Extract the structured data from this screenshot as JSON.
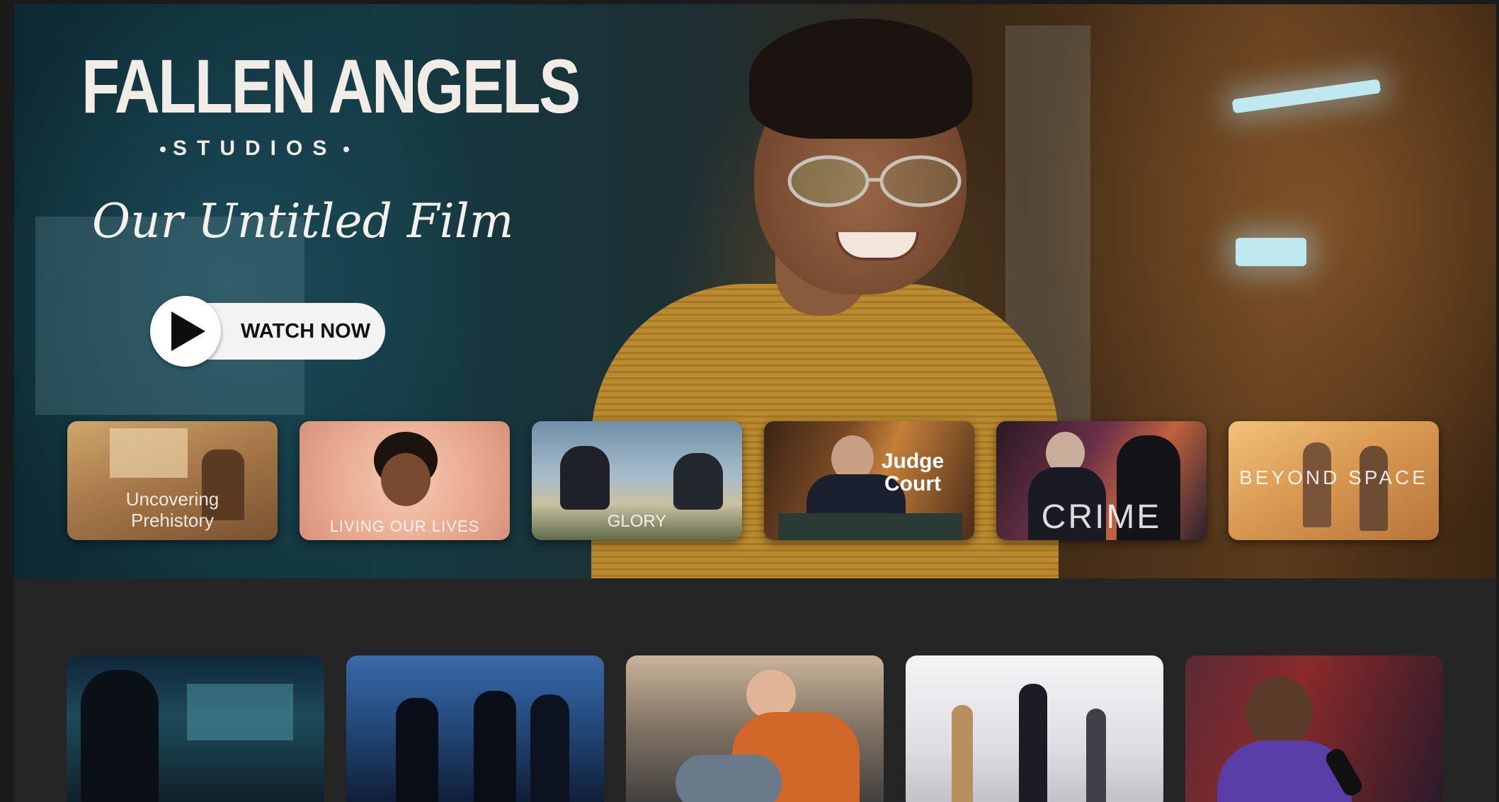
{
  "hero": {
    "logo_title": "FALLEN ANGELS",
    "logo_subtitle": "STUDIOS",
    "film_title": "Our Untitled Film",
    "watch_label": "WATCH NOW"
  },
  "featured_row": [
    {
      "title_line1": "Uncovering",
      "title_line2": "Prehistory"
    },
    {
      "title_line1": "LIVING OUR LIVES"
    },
    {
      "title_line1": "GLORY"
    },
    {
      "title_line1": "Judge",
      "title_line2": "Court"
    },
    {
      "title_line1": "CRIME"
    },
    {
      "title_line1": "BEYOND SPACE"
    }
  ],
  "icons": {
    "play": "play-icon"
  }
}
